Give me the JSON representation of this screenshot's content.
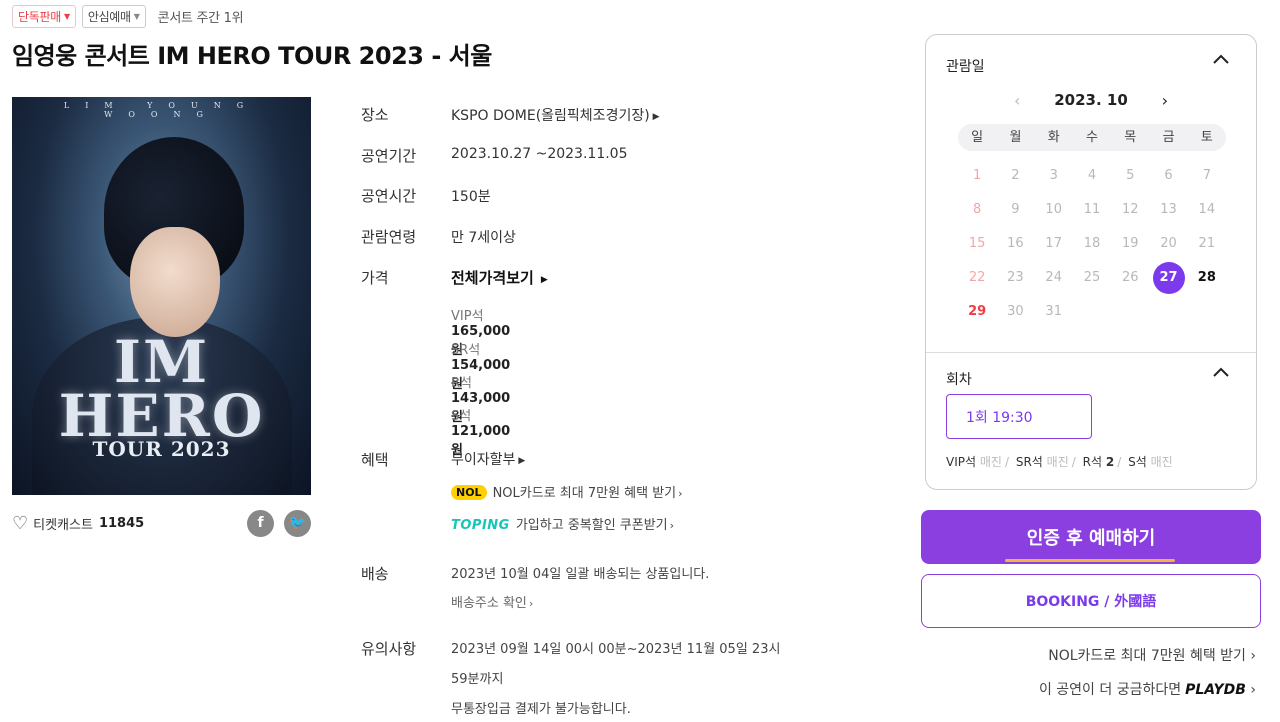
{
  "tags": [
    {
      "label": "단독판매",
      "style": "red"
    },
    {
      "label": "안심예매",
      "style": "gray"
    }
  ],
  "rank_text": "콘서트 주간 1위",
  "title": "임영웅 콘서트 IM HERO TOUR 2023 - 서울",
  "poster": {
    "top_text": "LIM YOUNG WOONG",
    "logo_line1": "IM",
    "logo_line2": "HERO",
    "tour": "TOUR 2023"
  },
  "like": {
    "label": "티켓캐스트",
    "count": "11845",
    "icon": "heart-outline-icon"
  },
  "share_icons": [
    "facebook-icon",
    "twitter-icon"
  ],
  "info": {
    "venue": {
      "label": "장소",
      "value": "KSPO DOME(올림픽체조경기장)"
    },
    "period": {
      "label": "공연기간",
      "value": "2023.10.27  ~2023.11.05"
    },
    "runtime": {
      "label": "공연시간",
      "value": "150분"
    },
    "age": {
      "label": "관람연령",
      "value": "만 7세이상"
    },
    "price": {
      "label": "가격",
      "view_all": "전체가격보기",
      "rows": [
        {
          "grade": "VIP석",
          "amount": "165,000원"
        },
        {
          "grade": "SR석",
          "amount": "154,000원"
        },
        {
          "grade": "R석",
          "amount": "143,000원"
        },
        {
          "grade": "S석",
          "amount": "121,000원"
        }
      ]
    },
    "benefit": {
      "label": "혜택",
      "installment": "무이자할부",
      "nol_badge": "NOL",
      "nol_text": "NOL카드로 최대 7만원 혜택 받기",
      "toping_badge": "TOPING",
      "toping_text": "가입하고 중복할인 쿠폰받기"
    },
    "delivery": {
      "label": "배송",
      "text": "2023년 10월 04일 일괄 배송되는 상품입니다.",
      "link": "배송주소 확인"
    },
    "notice": {
      "label": "유의사항",
      "line1": "2023년 09월 14일 00시 00분~2023년 11월 05일 23시",
      "line2": "59분까지",
      "line3": "무통장입금 결제가 불가능합니다."
    }
  },
  "calendar": {
    "section_title": "관람일",
    "month": "2023. 10",
    "weekdays": [
      "일",
      "월",
      "화",
      "수",
      "목",
      "금",
      "토"
    ],
    "weeks": [
      [
        "1",
        "2",
        "3",
        "4",
        "5",
        "6",
        "7"
      ],
      [
        "8",
        "9",
        "10",
        "11",
        "12",
        "13",
        "14"
      ],
      [
        "15",
        "16",
        "17",
        "18",
        "19",
        "20",
        "21"
      ],
      [
        "22",
        "23",
        "24",
        "25",
        "26",
        "27",
        "28"
      ],
      [
        "29",
        "30",
        "31",
        "",
        "",
        "",
        ""
      ]
    ],
    "available_days": [
      "27",
      "28",
      "29"
    ],
    "selected_day": "27"
  },
  "session": {
    "section_title": "회차",
    "time_label": "1회  19:30",
    "seats": [
      {
        "grade": "VIP석",
        "status": "매진"
      },
      {
        "grade": "SR석",
        "status": "매진"
      },
      {
        "grade": "R석",
        "status": "2"
      },
      {
        "grade": "S석",
        "status": "매진"
      }
    ]
  },
  "buttons": {
    "book": "인증 후 예매하기",
    "book_foreign": "BOOKING / 外國語"
  },
  "side_links": {
    "nol": "NOL카드로 최대 7만원 혜택 받기",
    "playdb_prefix": "이 공연이 더 궁금하다면",
    "playdb": "PLAYDB"
  },
  "colors": {
    "accent": "#8b3fe0",
    "red": "#ef3e43",
    "underline": "#f0b43c"
  }
}
